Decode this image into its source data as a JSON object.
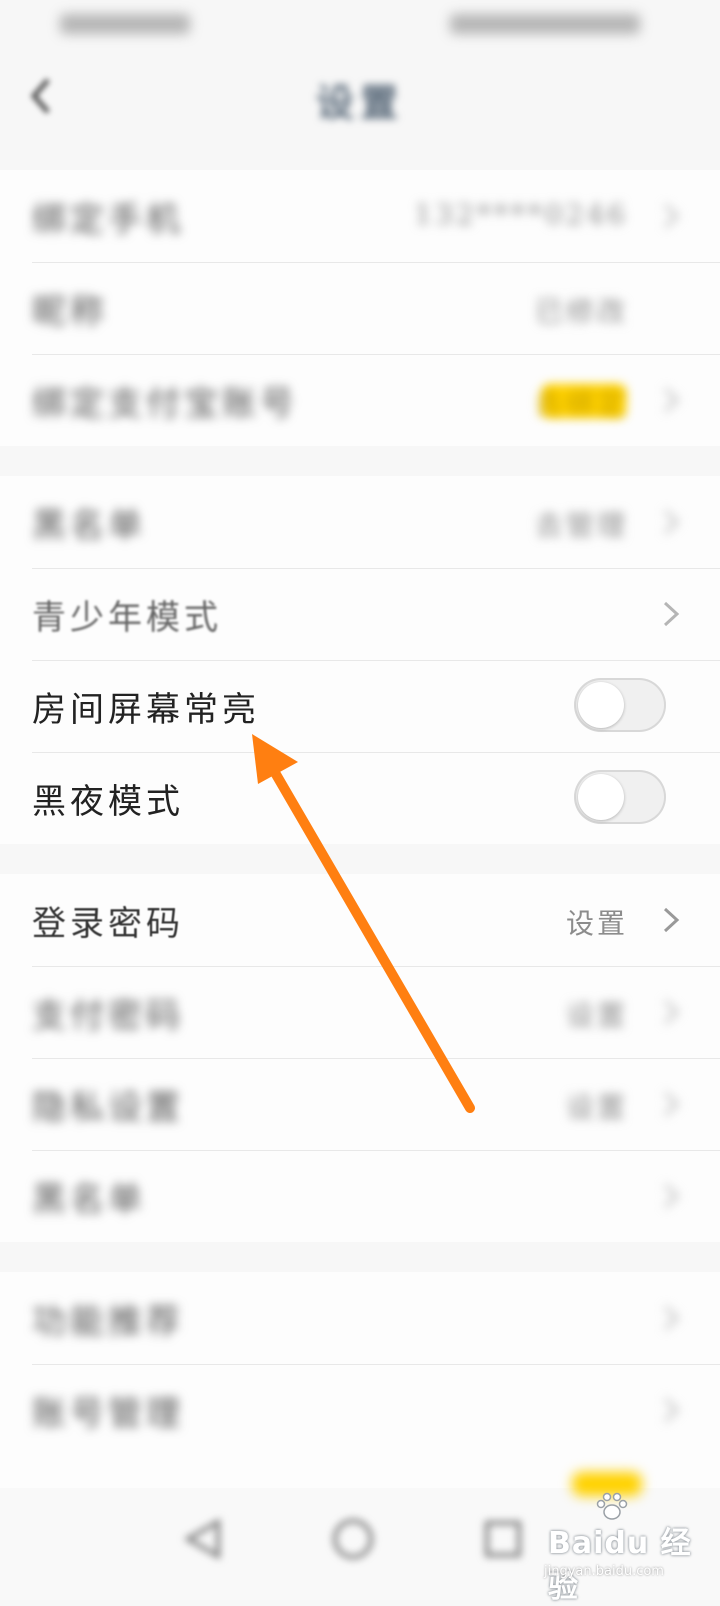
{
  "status_bar": {},
  "header": {
    "title": "设置"
  },
  "group1": {
    "items": [
      {
        "label": "绑定手机",
        "value": "132****0246"
      },
      {
        "label": "昵称",
        "value": "已修改"
      },
      {
        "label": "绑定支付宝账号",
        "value": "去绑定"
      }
    ]
  },
  "group2": {
    "items": [
      {
        "label": "黑名单",
        "value": "去管理"
      },
      {
        "label": "青少年模式"
      },
      {
        "label": "房间屏幕常亮",
        "toggle_on": false
      },
      {
        "label": "黑夜模式",
        "toggle_on": false
      }
    ]
  },
  "group3": {
    "items": [
      {
        "label": "登录密码",
        "value": "设置"
      },
      {
        "label": "支付密码",
        "value": "设置"
      },
      {
        "label": "隐私设置",
        "value": "设置"
      },
      {
        "label": "黑名单"
      }
    ]
  },
  "group4": {
    "items": [
      {
        "label": "功能推荐"
      },
      {
        "label": "账号管理"
      }
    ]
  },
  "colors": {
    "arrow": "#ff7f11",
    "badge": "#ffd200",
    "divider": "#e8e8e8"
  },
  "icons": {
    "back": "chevron-left-icon",
    "row_arrow": "chevron-right-icon",
    "nav_back": "triangle-back-icon",
    "nav_home": "circle-home-icon",
    "nav_recent": "square-recent-icon"
  },
  "watermark": {
    "brand": "Baidu 经验",
    "url": "jingyan.baidu.com"
  }
}
